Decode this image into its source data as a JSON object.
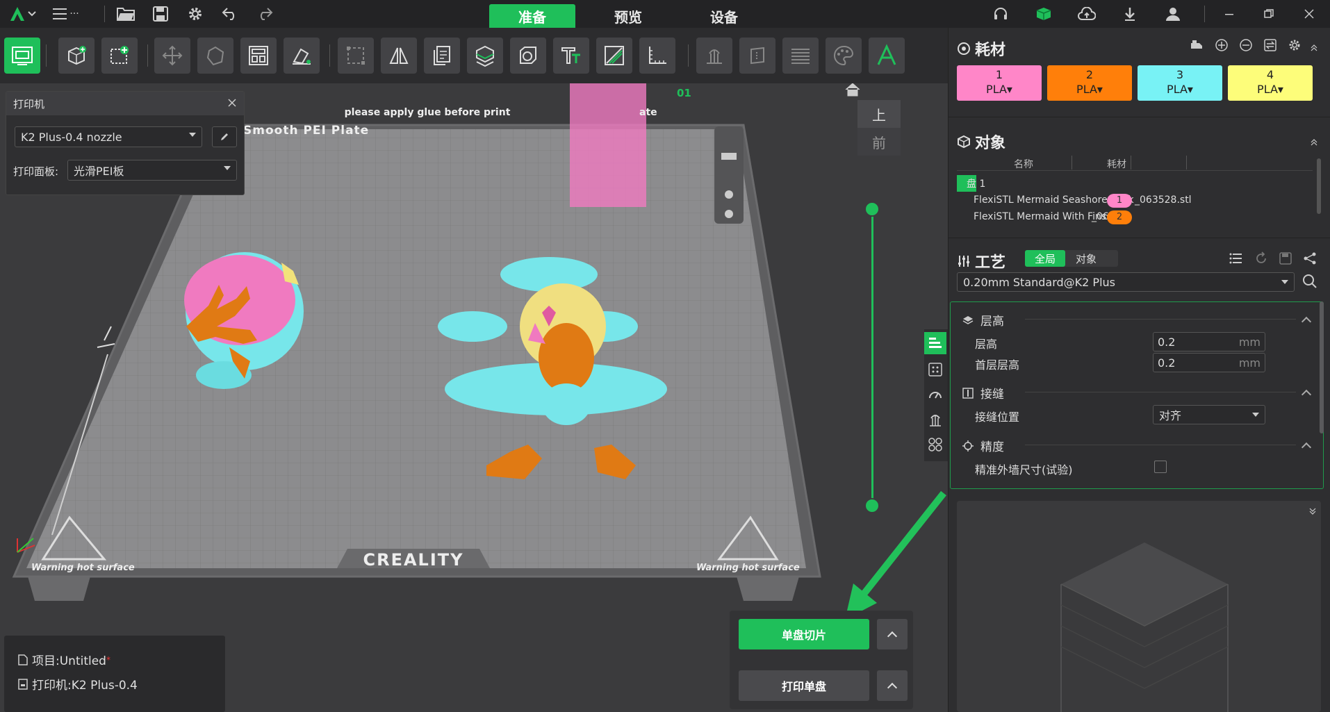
{
  "app": {
    "menu_dots": "···",
    "tabs": [
      {
        "label": "准备",
        "active": true
      },
      {
        "label": "预览",
        "active": false
      },
      {
        "label": "设备",
        "active": false
      }
    ]
  },
  "printer_panel": {
    "title": "打印机",
    "printer": "K2 Plus-0.4 nozzle",
    "plate_label": "打印面板:",
    "plate_value": "光滑PEI板"
  },
  "bed": {
    "top_text": "please apply glue before print",
    "plate_text": "Smooth PEI Plate",
    "brand": "CREALITY",
    "warning_left": "Warning hot surface",
    "warning_right": "Warning hot surface",
    "plate_number": "01",
    "right_text": "ate"
  },
  "view": {
    "top_label": "上",
    "front_label": "前"
  },
  "project": {
    "project_label": "项目:Untitled",
    "modified_mark": "*",
    "printer_label": "打印机:K2 Plus-0.4"
  },
  "actions": {
    "slice": "单盘切片",
    "print": "打印单盘"
  },
  "filament": {
    "title": "耗材",
    "items": [
      {
        "num": "1",
        "type": "PLA",
        "color": "#ff86c8"
      },
      {
        "num": "2",
        "type": "PLA",
        "color": "#ff7f0a"
      },
      {
        "num": "3",
        "type": "PLA",
        "color": "#78f2f5"
      },
      {
        "num": "4",
        "type": "PLA",
        "color": "#fdfd7a"
      }
    ]
  },
  "objects": {
    "title": "对象",
    "col_name": "名称",
    "col_filament": "耗材",
    "plate_row": "盘 1",
    "rows": [
      {
        "name": "FlexiSTL Mermaid Seashore Rock",
        "suffix": "_063528.stl",
        "filament": "1",
        "color": "#ff86c8"
      },
      {
        "name": "FlexiSTL Mermaid With Fins",
        "suffix": "_06415",
        "filament": "2",
        "color": "#ff7f0a"
      }
    ]
  },
  "process": {
    "title": "工艺",
    "toggle_global": "全局",
    "toggle_object": "对象",
    "preset": "0.20mm Standard@K2 Plus",
    "groups": {
      "layer": "层高",
      "seam": "接缝",
      "precision": "精度"
    },
    "layer_height_label": "层高",
    "layer_height_value": "0.2",
    "first_layer_label": "首层层高",
    "first_layer_value": "0.2",
    "unit": "mm",
    "seam_pos_label": "接缝位置",
    "seam_pos_value": "对齐",
    "precise_wall_label": "精准外墙尺寸(试验)"
  }
}
